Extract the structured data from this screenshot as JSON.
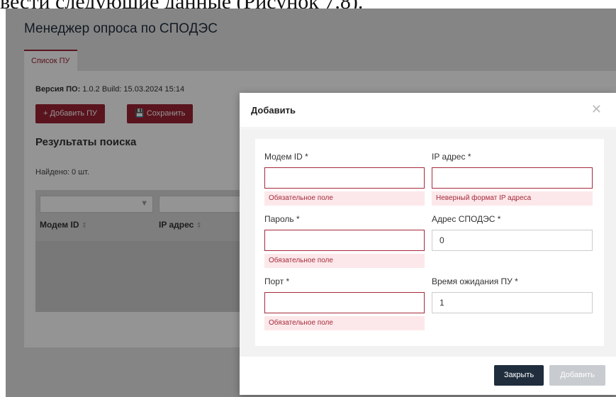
{
  "doc_caption": "вести следующие данные (Рисунок 7.8).",
  "app": {
    "title": "Менеджер опроса по СПОДЭС",
    "tab_label": "Список ПУ",
    "version_label": "Версия ПО:",
    "version_value": "1.0.2 Build: 15.03.2024 15:14",
    "add_button": "+ Добавить ПУ",
    "save_button": "Сохранить",
    "results_title": "Результаты поиска",
    "found_text": "Найдено: 0 шт.",
    "columns": [
      "Модем ID",
      "IP адрес"
    ]
  },
  "modal": {
    "title": "Добавить",
    "fields": {
      "modem_id": {
        "label": "Модем ID *",
        "value": "",
        "error": "Обязательное поле"
      },
      "ip": {
        "label": "IP адрес *",
        "value": "",
        "error": "Неверный формат IP адреса"
      },
      "password": {
        "label": "Пароль *",
        "value": "",
        "error": "Обязательное поле"
      },
      "spodes_addr": {
        "label": "Адрес СПОДЭС *",
        "value": "0"
      },
      "port": {
        "label": "Порт *",
        "value": "",
        "error": "Обязательное поле"
      },
      "timeout": {
        "label": "Время ожидания ПУ *",
        "value": "1"
      }
    },
    "close_button": "Закрыть",
    "submit_button": "Добавить"
  },
  "icons": {
    "filter": "filter-icon",
    "sort": "sort-icon",
    "save": "floppy-disk-icon",
    "close": "close-icon"
  }
}
